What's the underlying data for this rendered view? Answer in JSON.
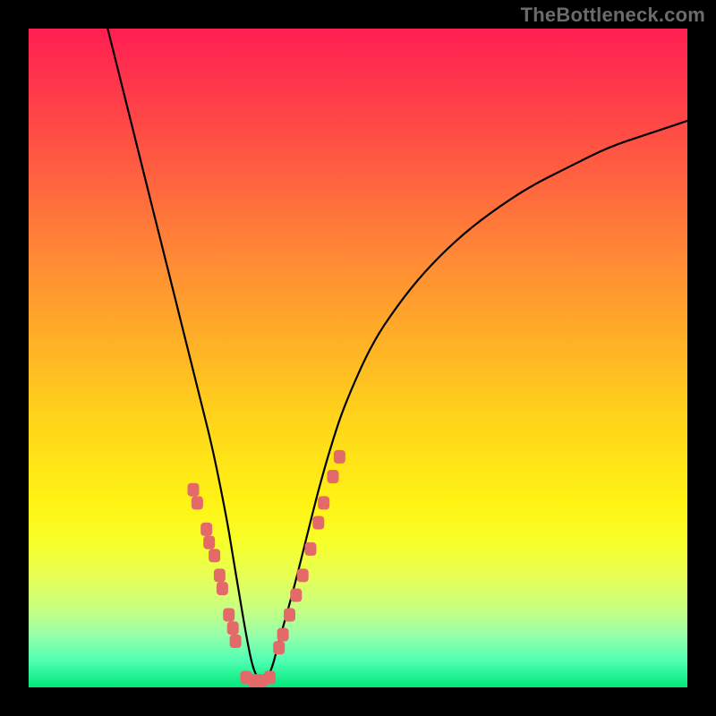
{
  "watermark": "TheBottleneck.com",
  "chart_data": {
    "type": "line",
    "title": "",
    "xlabel": "",
    "ylabel": "",
    "xlim": [
      0,
      100
    ],
    "ylim": [
      0,
      100
    ],
    "grid": false,
    "legend": false,
    "series": [
      {
        "name": "bottleneck-curve",
        "color": "#000000",
        "x": [
          12,
          14,
          16,
          18,
          20,
          22,
          24,
          26,
          28,
          30,
          31,
          32,
          33,
          34,
          35,
          36,
          37,
          38,
          40,
          42,
          44,
          46,
          48,
          52,
          56,
          60,
          65,
          70,
          76,
          82,
          88,
          94,
          100
        ],
        "y": [
          100,
          92,
          84,
          76,
          68,
          60,
          52,
          44,
          36,
          26,
          20,
          14,
          8,
          3,
          1,
          1,
          3,
          7,
          14,
          22,
          30,
          37,
          43,
          52,
          58,
          63,
          68,
          72,
          76,
          79,
          82,
          84,
          86
        ]
      }
    ],
    "markers": [
      {
        "name": "left-cluster",
        "color": "#e46a6a",
        "points": [
          {
            "x": 25.0,
            "y": 30
          },
          {
            "x": 25.6,
            "y": 28
          },
          {
            "x": 27.0,
            "y": 24
          },
          {
            "x": 27.4,
            "y": 22
          },
          {
            "x": 28.2,
            "y": 20
          },
          {
            "x": 29.0,
            "y": 17
          },
          {
            "x": 29.4,
            "y": 15
          },
          {
            "x": 30.4,
            "y": 11
          },
          {
            "x": 31.0,
            "y": 9
          },
          {
            "x": 31.4,
            "y": 7
          }
        ]
      },
      {
        "name": "bottom-cluster",
        "color": "#e46a6a",
        "points": [
          {
            "x": 33.0,
            "y": 1.5
          },
          {
            "x": 34.2,
            "y": 1.0
          },
          {
            "x": 35.4,
            "y": 1.0
          },
          {
            "x": 36.6,
            "y": 1.5
          }
        ]
      },
      {
        "name": "right-cluster",
        "color": "#e46a6a",
        "points": [
          {
            "x": 38.0,
            "y": 6
          },
          {
            "x": 38.6,
            "y": 8
          },
          {
            "x": 39.6,
            "y": 11
          },
          {
            "x": 40.6,
            "y": 14
          },
          {
            "x": 41.6,
            "y": 17
          },
          {
            "x": 42.8,
            "y": 21
          },
          {
            "x": 44.0,
            "y": 25
          },
          {
            "x": 44.8,
            "y": 28
          },
          {
            "x": 46.2,
            "y": 32
          },
          {
            "x": 47.2,
            "y": 35
          }
        ]
      }
    ]
  }
}
